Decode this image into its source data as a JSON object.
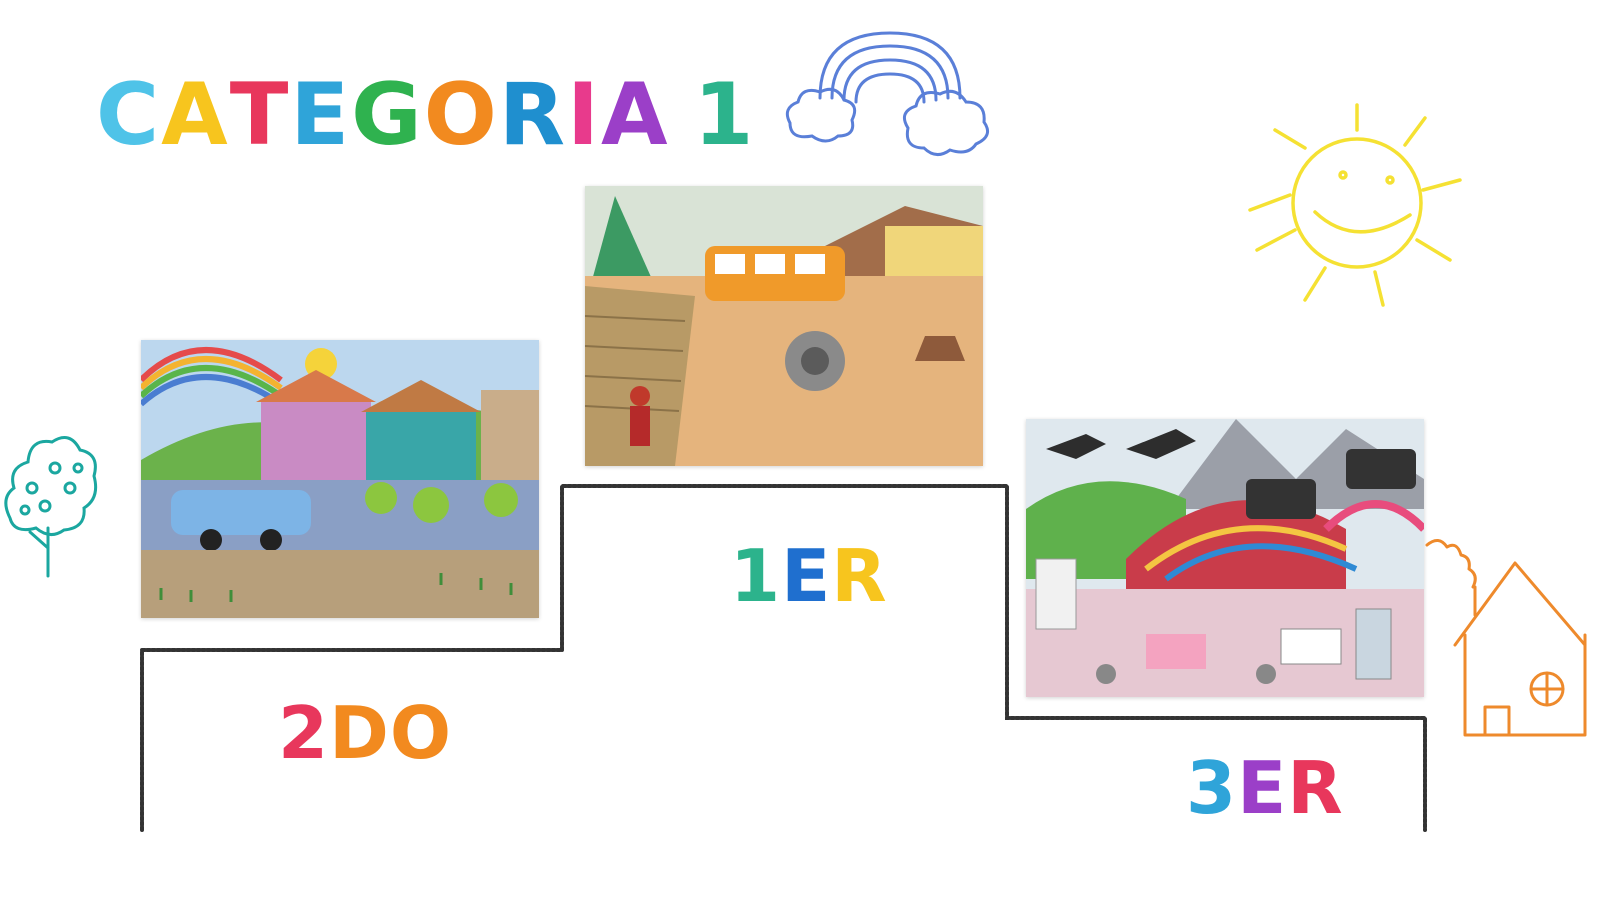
{
  "title": {
    "letters": [
      "C",
      "A",
      "T",
      "E",
      "G",
      "O",
      "R",
      "I",
      "A",
      " ",
      "1"
    ],
    "colors": [
      "#4fc3e8",
      "#f7c51e",
      "#e8375c",
      "#2fa4d9",
      "#2fb24f",
      "#f28a1f",
      "#1f8fcf",
      "#e83a8c",
      "#9b3fc8",
      "#ffffff",
      "#2cb38c"
    ]
  },
  "places": {
    "first": {
      "letters": [
        "1",
        "E",
        "R"
      ],
      "colors": [
        "#2cb38c",
        "#1f6fcf",
        "#f7c51e"
      ]
    },
    "second": {
      "letters": [
        "2",
        "D",
        "O"
      ],
      "colors": [
        "#e8375c",
        "#f28a1f",
        "#f28a1f"
      ]
    },
    "third": {
      "letters": [
        "3",
        "E",
        "R"
      ],
      "colors": [
        "#2fa4d9",
        "#9b3fc8",
        "#e8375c"
      ]
    }
  },
  "colors": {
    "rainbow": "#5a7fd8",
    "sun": "#f5e133",
    "tree": "#1ba7a0",
    "house": "#ee8a2c",
    "podium": "#333333"
  },
  "icons": [
    "rainbow-cloud-doodle",
    "sun-doodle",
    "tree-doodle",
    "house-doodle"
  ]
}
